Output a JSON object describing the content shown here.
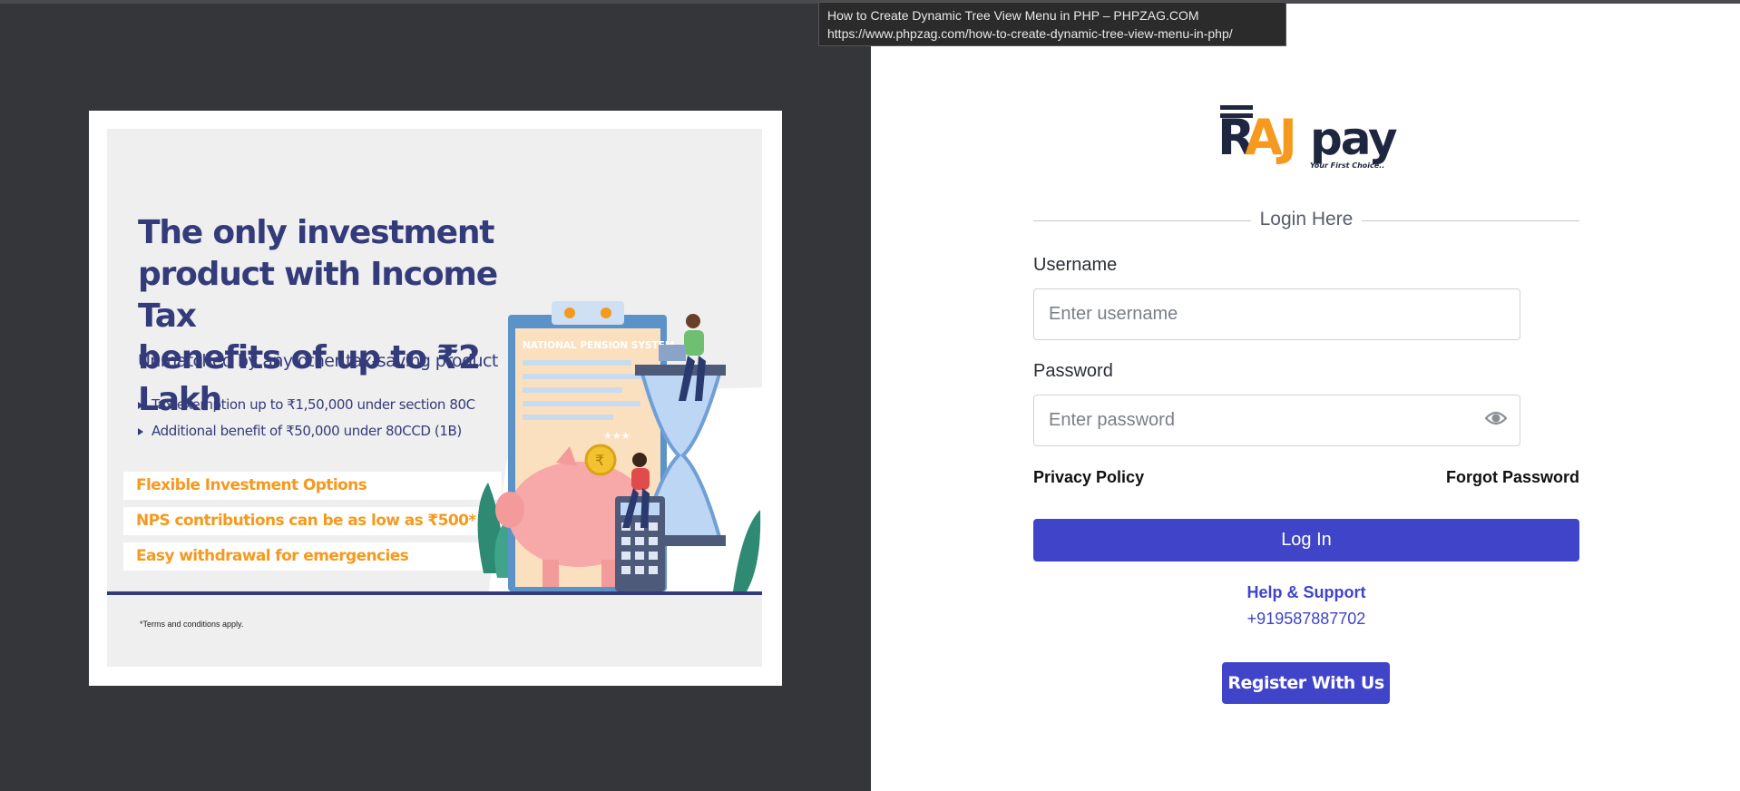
{
  "tooltip": {
    "title": "How to Create Dynamic Tree View Menu in PHP – PHPZAG.COM",
    "url": "https://www.phpzag.com/how-to-create-dynamic-tree-view-menu-in-php/"
  },
  "banner": {
    "headline_1": "The only investment",
    "headline_2": "product with Income Tax",
    "headline_3": "benefits of up to ₹2 Lakh",
    "subline": "Unmatched by any other tax-saving product",
    "bullets": [
      "Tax exemption up to ₹1,50,000 under section 80C",
      "Additional benefit of ₹50,000 under 80CCD (1B)"
    ],
    "features": [
      "Flexible Investment Options",
      "NPS contributions can be as low as ₹500*",
      "Easy withdrawal for emergencies"
    ],
    "terms": "*Terms and conditions apply.",
    "illustration_label": "NATIONAL PENSION SYSTEM",
    "colors": {
      "navy": "#343b7a",
      "orange": "#f59a1e"
    }
  },
  "logo": {
    "text_raj": "RAJ",
    "text_pay": "pay",
    "tagline": "Your First Choice.."
  },
  "login": {
    "heading": "Login Here",
    "username_label": "Username",
    "username_placeholder": "Enter username",
    "password_label": "Password",
    "password_placeholder": "Enter password",
    "privacy_policy": "Privacy Policy",
    "forgot_password": "Forgot Password",
    "login_button": "Log In",
    "help_support": "Help & Support",
    "phone": "+919587887702",
    "register_button": "Register With Us",
    "accent_color": "#3f44c9"
  }
}
